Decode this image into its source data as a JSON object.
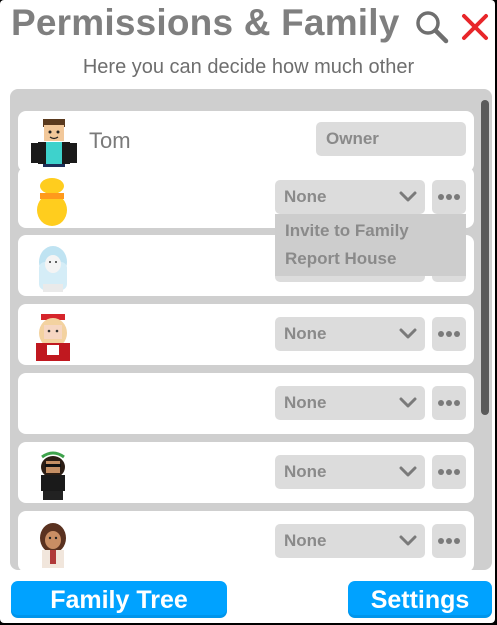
{
  "header": {
    "title": "Permissions & Family",
    "subtitle": "Here you can decide how much other",
    "search_icon": "search-icon",
    "close_icon": "close-icon",
    "close_color": "#e8262a"
  },
  "rows": [
    {
      "name": "Tom",
      "role": "Owner",
      "type": "owner"
    },
    {
      "name": "",
      "role": "None",
      "type": "member"
    },
    {
      "name": "",
      "role": "None",
      "type": "member"
    },
    {
      "name": "",
      "role": "None",
      "type": "member"
    },
    {
      "name": "",
      "role": "None",
      "type": "member"
    },
    {
      "name": "",
      "role": "None",
      "type": "member"
    },
    {
      "name": "",
      "role": "None",
      "type": "member"
    }
  ],
  "context_menu": {
    "items": [
      "Invite to Family",
      "Report House"
    ]
  },
  "footer": {
    "family_tree_label": "Family Tree",
    "settings_label": "Settings",
    "accent": "#00a2ff"
  }
}
